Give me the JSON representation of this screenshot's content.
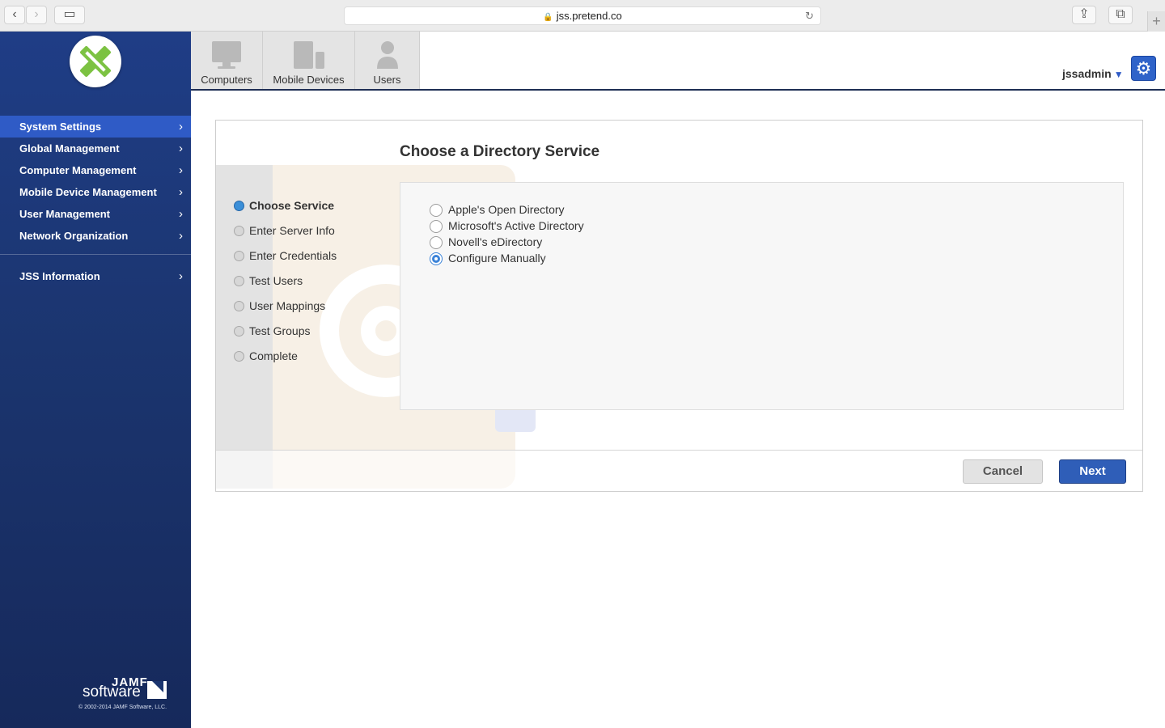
{
  "browser": {
    "url": "jss.pretend.co",
    "back_glyph": "‹",
    "forward_glyph": "›",
    "sidebar_glyph": "▭",
    "reload_glyph": "↻",
    "share_glyph": "⇪",
    "tabs_glyph": "⧉",
    "new_tab_glyph": "+"
  },
  "sidebar": {
    "items": [
      {
        "label": "System Settings",
        "active": true
      },
      {
        "label": "Global Management",
        "active": false
      },
      {
        "label": "Computer Management",
        "active": false
      },
      {
        "label": "Mobile Device Management",
        "active": false
      },
      {
        "label": "User Management",
        "active": false
      },
      {
        "label": "Network Organization",
        "active": false
      }
    ],
    "info_item": {
      "label": "JSS Information"
    },
    "chevron": "›",
    "brand_top": "JAMF",
    "brand_bottom": "software",
    "copyright": "© 2002-2014 JAMF Software, LLC."
  },
  "topbar": {
    "tabs": [
      {
        "label": "Computers",
        "icon": "computer-icon"
      },
      {
        "label": "Mobile Devices",
        "icon": "mobile-devices-icon"
      },
      {
        "label": "Users",
        "icon": "user-icon"
      }
    ],
    "username": "jssadmin",
    "caret": "▼",
    "gear": "⚙"
  },
  "wizard": {
    "title": "Choose a Directory Service",
    "steps": [
      {
        "label": "Choose Service",
        "active": true
      },
      {
        "label": "Enter Server Info",
        "active": false
      },
      {
        "label": "Enter Credentials",
        "active": false
      },
      {
        "label": "Test Users",
        "active": false
      },
      {
        "label": "User Mappings",
        "active": false
      },
      {
        "label": "Test Groups",
        "active": false
      },
      {
        "label": "Complete",
        "active": false
      }
    ],
    "options": [
      {
        "label": "Apple's Open Directory",
        "selected": false
      },
      {
        "label": "Microsoft's Active Directory",
        "selected": false
      },
      {
        "label": "Novell's eDirectory",
        "selected": false
      },
      {
        "label": "Configure Manually",
        "selected": true
      }
    ],
    "cancel_label": "Cancel",
    "next_label": "Next"
  },
  "colors": {
    "sidebar_top": "#1f3d86",
    "sidebar_active": "#2f5bc6",
    "accent": "#2f5eb8",
    "logo_green": "#7cc242"
  }
}
